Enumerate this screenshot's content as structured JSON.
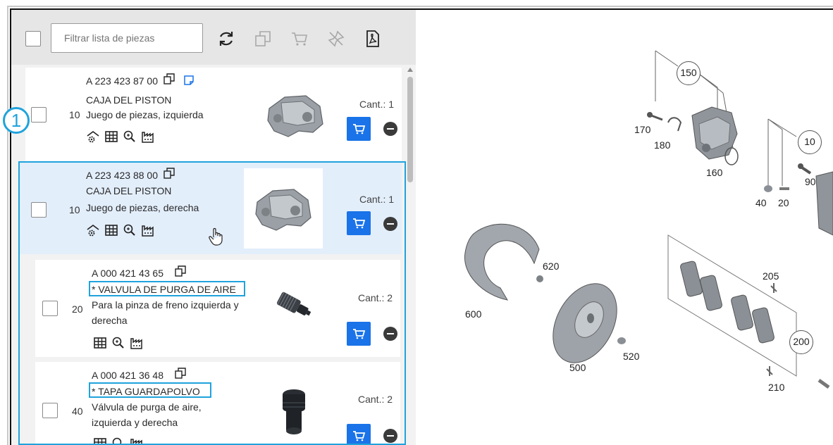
{
  "toolbar": {
    "filter_placeholder": "Filtrar lista de piezas",
    "icons": [
      "refresh-icon",
      "copy-icon",
      "cart-icon",
      "unpin-icon",
      "pdf-icon"
    ]
  },
  "badge": {
    "number": "1"
  },
  "parts": [
    {
      "part_number": "A 223 423 87 00",
      "name": "CAJA DEL PISTON",
      "position": "10",
      "description": "Juego de piezas, izquierda",
      "quantity": "Cant.: 1",
      "has_note": true,
      "selected": false
    },
    {
      "part_number": "A 223 423 88 00",
      "name": "CAJA DEL PISTON",
      "position": "10",
      "description": "Juego de piezas, derecha",
      "quantity": "Cant.: 1",
      "selected": true
    },
    {
      "part_number": "A 000 421 43 65",
      "name": "* VALVULA DE PURGA DE AIRE",
      "position": "20",
      "description_line1": "Para la pinza de freno izquierda y",
      "description_line2": "derecha",
      "quantity": "Cant.: 2"
    },
    {
      "part_number": "A 000 421 36 48",
      "name": "* TAPA GUARDAPOLVO",
      "position": "40",
      "description_line1": "Válvula de purga de aire,",
      "description_line2": "izquierda y derecha",
      "quantity": "Cant.: 2"
    }
  ],
  "diagram": {
    "labels": {
      "l150": "150",
      "l170": "170",
      "l180": "180",
      "l160": "160",
      "l10": "10",
      "l90": "90",
      "l40": "40",
      "l20": "20",
      "l620": "620",
      "l600": "600",
      "l500": "500",
      "l520": "520",
      "l205": "205",
      "l200": "200",
      "l210": "210"
    }
  },
  "colors": {
    "accent": "#1a73e8",
    "highlight": "#1fa3dc",
    "selected_bg": "#e3eefb"
  }
}
